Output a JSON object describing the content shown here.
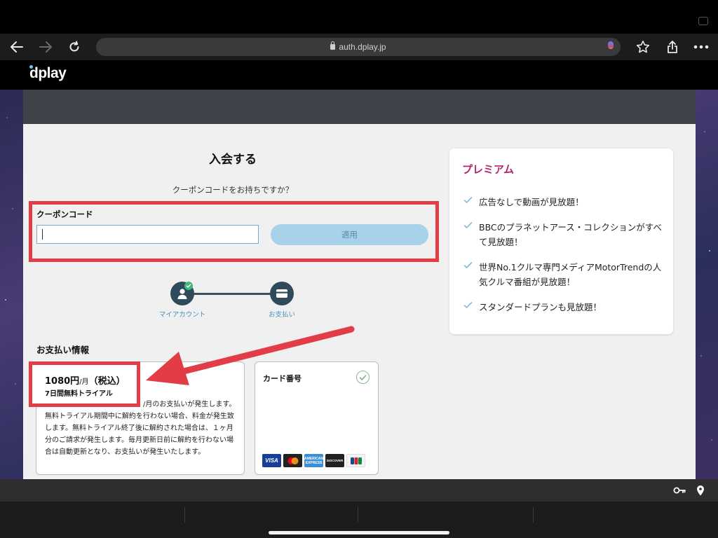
{
  "browser": {
    "url": "auth.dplay.jp"
  },
  "site": {
    "logo": "dplay"
  },
  "form": {
    "title": "入会する",
    "coupon_question": "クーポンコードをお持ちですか？",
    "coupon_label": "クーポンコード",
    "coupon_value": "",
    "apply_label": "適用"
  },
  "steps": [
    {
      "label": "マイアカウント",
      "completed": true
    },
    {
      "label": "お支払い",
      "completed": false
    }
  ],
  "payment": {
    "section_title": "お支払い情報",
    "price": "1080円",
    "per_month": "/月",
    "tax_included": "（税込）",
    "trial": "7日間無料トライアル",
    "description_line1": "　　　　　　　　　　　　　　/月のお支払いが発生しま",
    "description_rest": "す。無料トライアル期間中に解約を行わない場合、料金が発生致します。無料トライアル終了後に解約された場合は、１ヶ月分のご請求が発生します。毎月更新日前に解約を行わない場合は自動更新となり、お支払いが発生いたします。",
    "card_label": "カード番号",
    "brands": [
      "VISA",
      "MasterCard",
      "AMERICAN EXPRESS",
      "DISCOVER",
      "JCB"
    ]
  },
  "premium": {
    "title": "プレミアム",
    "features": [
      "広告なしで動画が見放題！",
      "BBCのプラネットアース・コレクションがすべて見放題！",
      "世界No.1クルマ専門メディアMotorTrendの人気クルマ番組が見放題！",
      "スタンダードプランも見放題！"
    ]
  },
  "colors": {
    "accent_red": "#e23c47",
    "premium_title": "#b4256f",
    "apply_button": "#a7d2ea",
    "step_circle": "#2f4a5a",
    "check_green": "#43b57b"
  },
  "icons": [
    "back-icon",
    "forward-icon",
    "reload-icon",
    "lock-icon",
    "microphone-icon",
    "star-icon",
    "share-icon",
    "more-icon",
    "key-icon",
    "location-pin-icon"
  ]
}
